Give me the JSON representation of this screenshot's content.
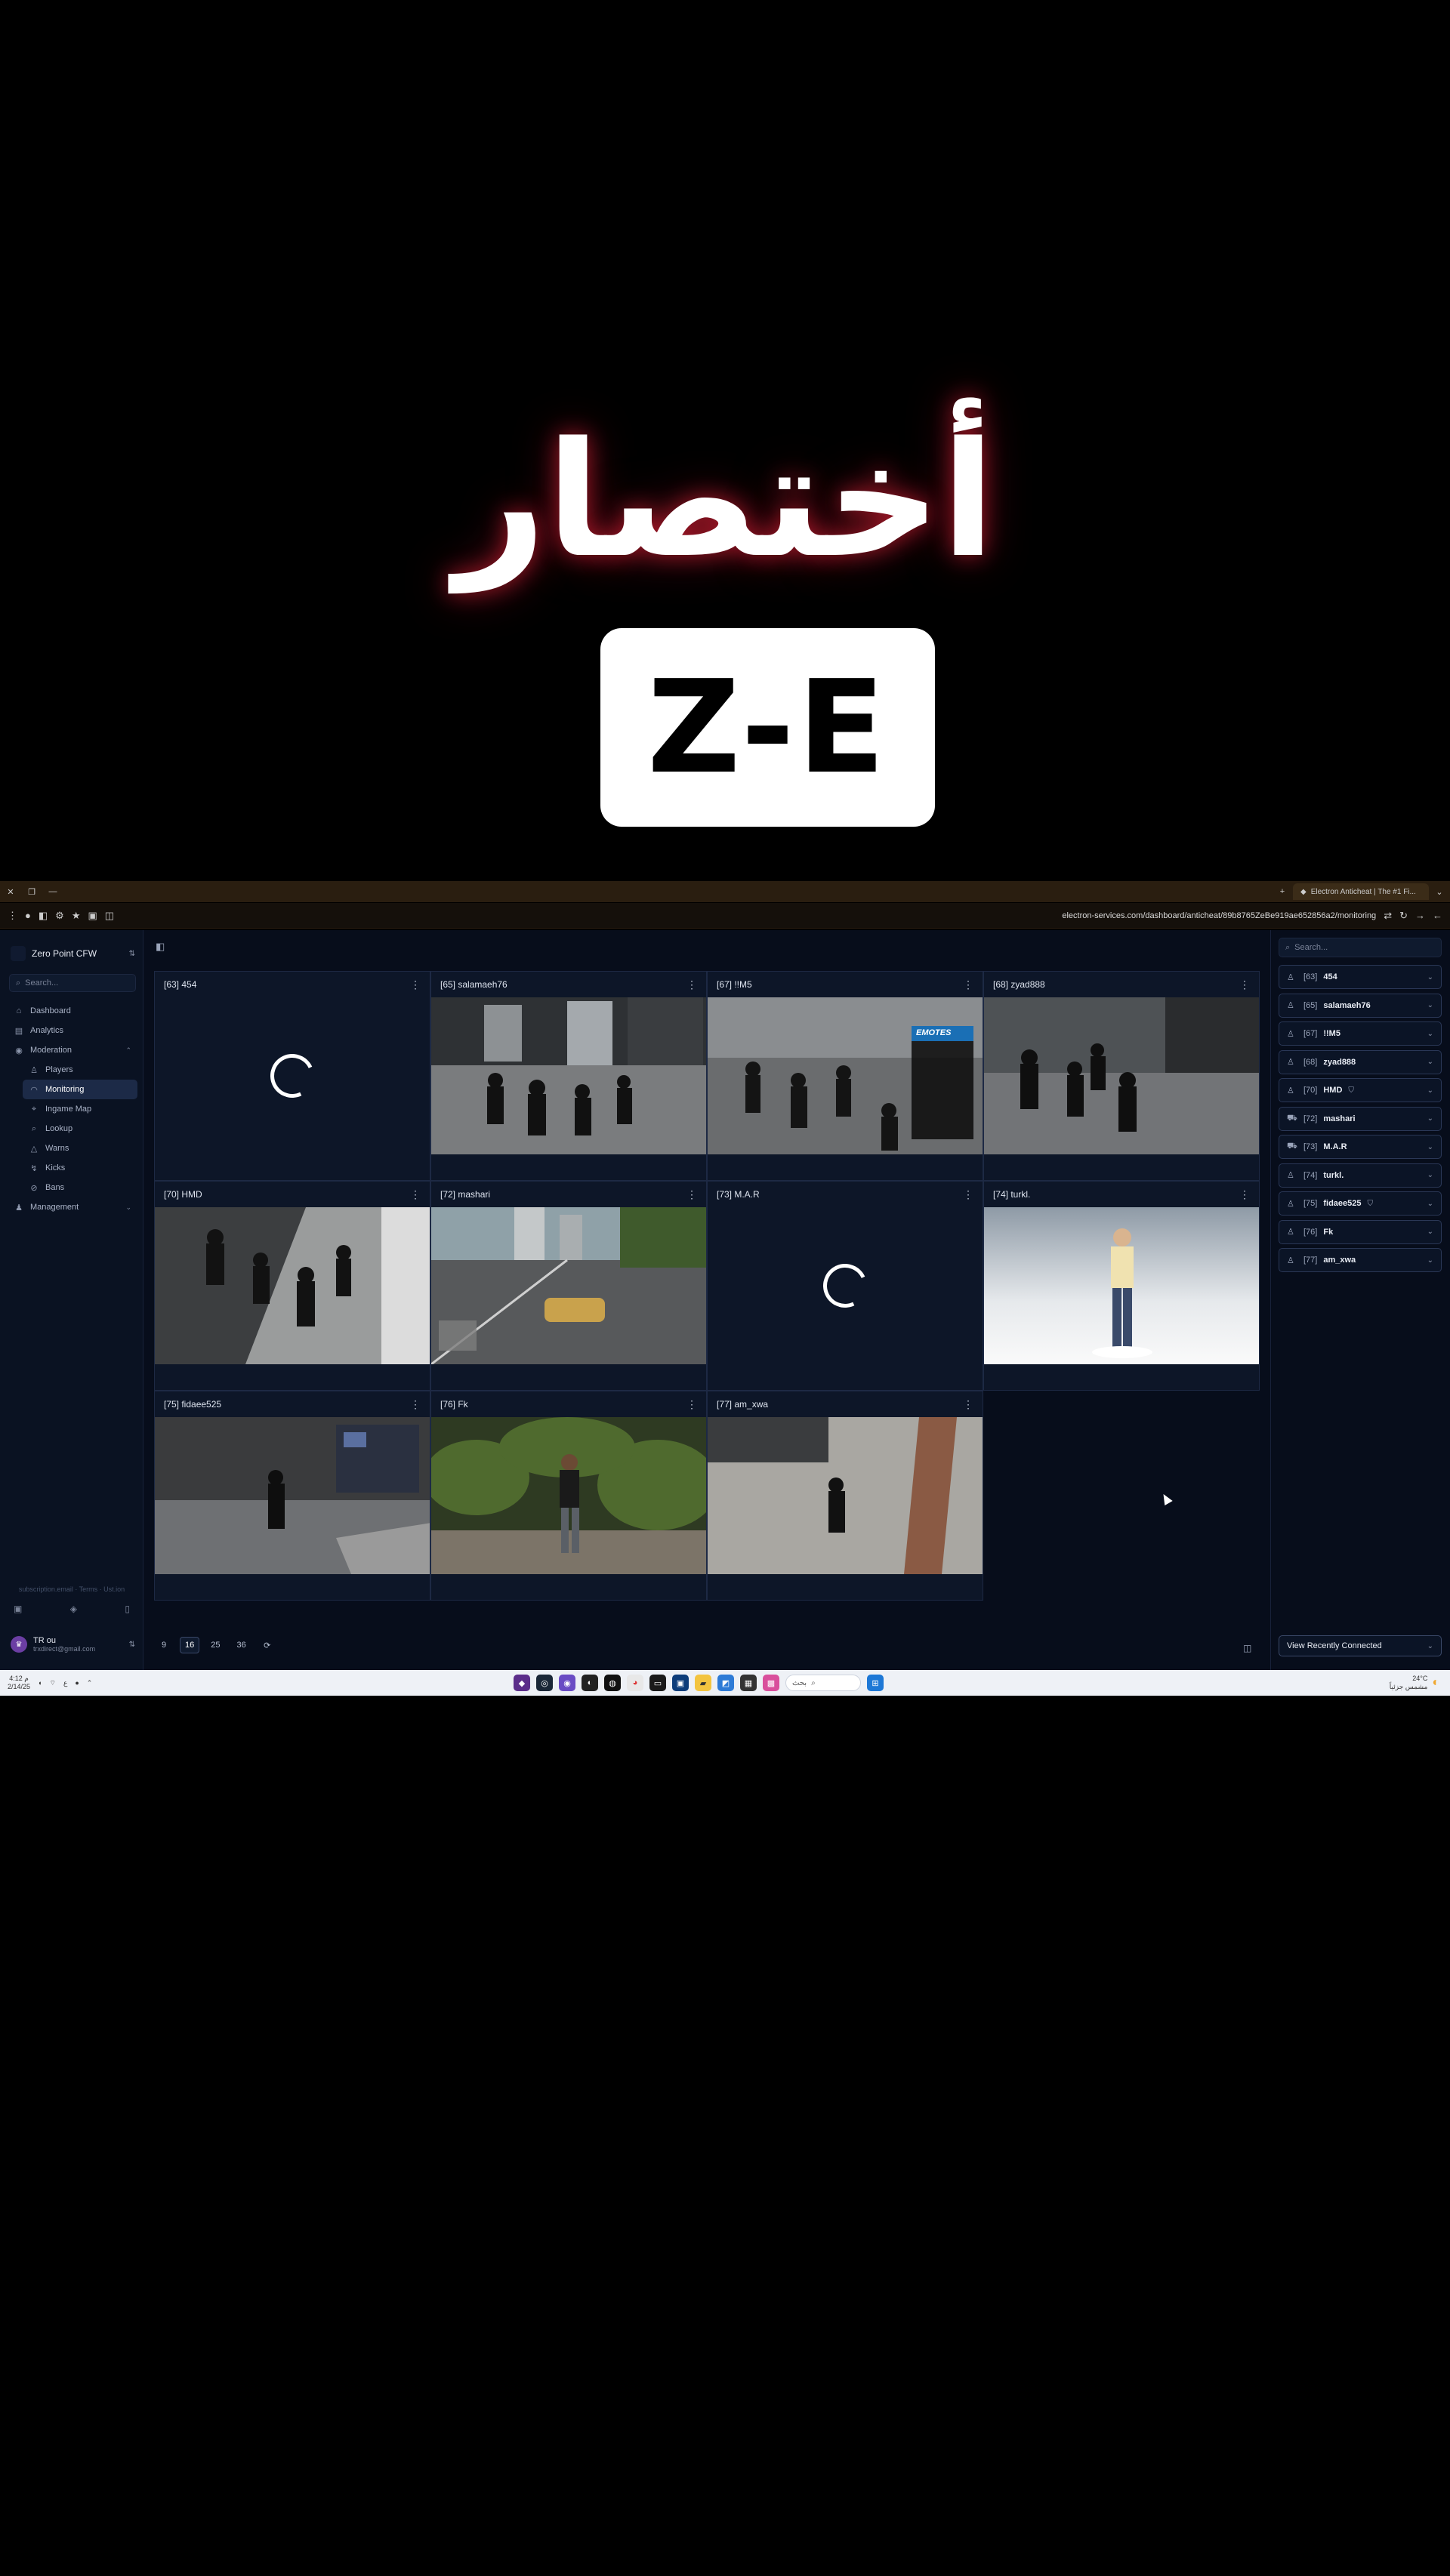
{
  "overlay": {
    "title": "أختصار",
    "shortcut": "Z-E"
  },
  "browser": {
    "tab_title": "Electron Anticheat | The #1 Fi...",
    "url": "electron-services.com/dashboard/anticheat/89b8765ZeBe919ae652856a2/monitoring"
  },
  "sidebar": {
    "org_name": "Zero Point CFW",
    "search_placeholder": "Search...",
    "nav": [
      {
        "label": "Dashboard",
        "icon": "home-icon"
      },
      {
        "label": "Analytics",
        "icon": "chart-icon"
      },
      {
        "label": "Moderation",
        "icon": "shield-icon"
      }
    ],
    "sub_nav": [
      {
        "label": "Players",
        "icon": "user-icon"
      },
      {
        "label": "Monitoring",
        "icon": "monitor-icon"
      },
      {
        "label": "Ingame Map",
        "icon": "map-icon"
      },
      {
        "label": "Lookup",
        "icon": "lookup-icon"
      },
      {
        "label": "Warns",
        "icon": "warn-icon"
      },
      {
        "label": "Kicks",
        "icon": "kick-icon"
      },
      {
        "label": "Bans",
        "icon": "ban-icon"
      }
    ],
    "management": "Management",
    "footer_text": "subscription.email · Terms · Ust.ion",
    "user": {
      "name": "TR ou",
      "email": "trxdirect@gmail.com"
    }
  },
  "tiles": [
    {
      "label": "[63] 454",
      "loading": true
    },
    {
      "label": "[65] salamaeh76",
      "loading": false,
      "scene": "office"
    },
    {
      "label": "[67] !!M5",
      "loading": false,
      "scene": "emotes",
      "menu_title": "EMOTES"
    },
    {
      "label": "[68] zyad888",
      "loading": false,
      "scene": "office"
    },
    {
      "label": "[70] HMD",
      "loading": false,
      "scene": "tile-floor"
    },
    {
      "label": "[72] mashari",
      "loading": false,
      "scene": "street"
    },
    {
      "label": "[73] M.A.R",
      "loading": true
    },
    {
      "label": "[74] turkl.",
      "loading": false,
      "scene": "character"
    },
    {
      "label": "[75] fidaee525",
      "loading": false,
      "scene": "lobby"
    },
    {
      "label": "[76] Fk",
      "loading": false,
      "scene": "garden"
    },
    {
      "label": "[77] am_xwa",
      "loading": false,
      "scene": "courtyard"
    }
  ],
  "pagination": {
    "options": [
      "9",
      "16",
      "25",
      "36",
      "⟳"
    ],
    "active": "16"
  },
  "right_panel": {
    "search_placeholder": "Search...",
    "players": [
      {
        "id": "[63]",
        "name": "454",
        "shield": false,
        "icon": "user-plus-icon"
      },
      {
        "id": "[65]",
        "name": "salamaeh76",
        "shield": false,
        "icon": "user-plus-icon"
      },
      {
        "id": "[67]",
        "name": "!!M5",
        "shield": false,
        "icon": "user-plus-icon"
      },
      {
        "id": "[68]",
        "name": "zyad888",
        "shield": false,
        "icon": "user-plus-icon"
      },
      {
        "id": "[70]",
        "name": "HMD",
        "shield": true,
        "icon": "user-plus-icon"
      },
      {
        "id": "[72]",
        "name": "mashari",
        "shield": false,
        "icon": "car-icon"
      },
      {
        "id": "[73]",
        "name": "M.A.R",
        "shield": false,
        "icon": "car-icon"
      },
      {
        "id": "[74]",
        "name": "turkl.",
        "shield": false,
        "icon": "user-plus-icon"
      },
      {
        "id": "[75]",
        "name": "fidaee525",
        "shield": true,
        "icon": "user-plus-icon"
      },
      {
        "id": "[76]",
        "name": "Fk",
        "shield": false,
        "icon": "user-plus-icon"
      },
      {
        "id": "[77]",
        "name": "am_xwa",
        "shield": false,
        "icon": "user-plus-icon"
      }
    ],
    "filter": "View Recently Connected"
  },
  "taskbar": {
    "time_left": "4:12 م",
    "date_left": "2/14/25",
    "search_text": "بحث",
    "weather_temp": "24°C",
    "weather_desc": "مشمس جزئياً"
  },
  "colors": {
    "accent": "#1c2a47",
    "bg": "#070d1b",
    "glow": "#c81e32"
  }
}
